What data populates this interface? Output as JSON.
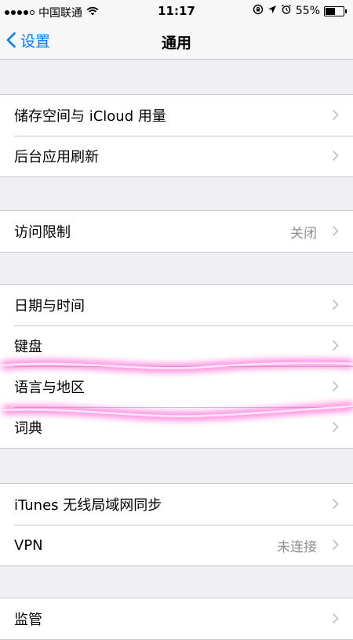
{
  "status_bar": {
    "carrier": "中国联通",
    "time": "11:17",
    "battery_percent": "55%",
    "battery_level": 0.55,
    "icons": [
      "signal-dots-icon",
      "wifi-icon",
      "rotation-lock-icon",
      "location-arrow-icon",
      "alarm-icon",
      "battery-icon"
    ]
  },
  "nav": {
    "back_label": "设置",
    "title": "通用"
  },
  "colors": {
    "accent": "#007aff",
    "highlighter": "#ff3cc8",
    "background": "#efeff4",
    "secondary_text": "#8e8e93"
  },
  "groups": [
    {
      "rows": [
        {
          "label": "储存空间与 iCloud 用量"
        },
        {
          "label": "后台应用刷新"
        }
      ]
    },
    {
      "rows": [
        {
          "label": "访问限制",
          "value": "关闭"
        }
      ]
    },
    {
      "rows": [
        {
          "label": "日期与时间"
        },
        {
          "label": "键盘"
        },
        {
          "label": "语言与地区"
        },
        {
          "label": "词典"
        }
      ]
    },
    {
      "rows": [
        {
          "label": "iTunes 无线局域网同步"
        },
        {
          "label": "VPN",
          "value": "未连接"
        }
      ]
    },
    {
      "rows": [
        {
          "label": "监管"
        }
      ]
    }
  ]
}
